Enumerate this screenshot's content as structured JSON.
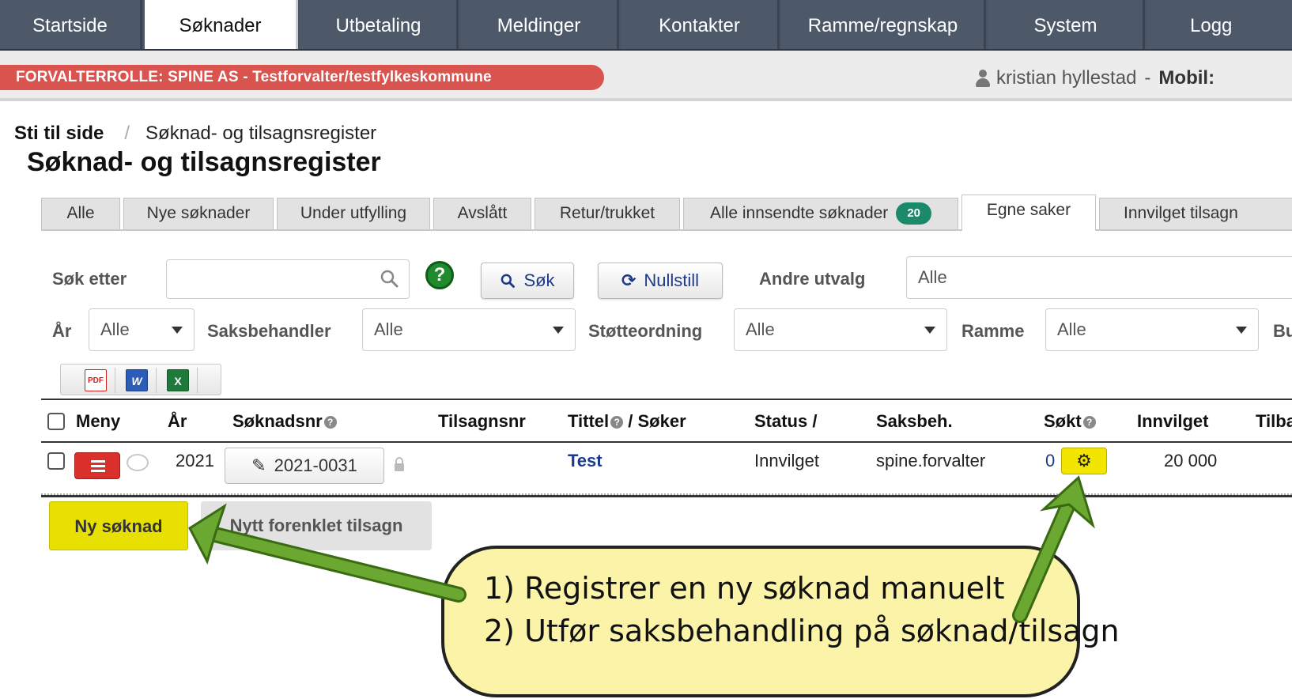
{
  "nav": {
    "tabs": [
      {
        "label": "Startside"
      },
      {
        "label": "Søknader"
      },
      {
        "label": "Utbetaling"
      },
      {
        "label": "Meldinger"
      },
      {
        "label": "Kontakter"
      },
      {
        "label": "Ramme/regnskap"
      },
      {
        "label": "System"
      },
      {
        "label": "Logg"
      }
    ],
    "active": "Søknader"
  },
  "rolebar": {
    "role": "FORVALTERROLLE: SPINE AS - Testforvalter/testfylkeskommune",
    "user_name": "kristian hyllestad",
    "user_sep": "-",
    "user_extra": "Mobil:"
  },
  "breadcrumb": {
    "root": "Sti til side",
    "separator": "/",
    "current": "Søknad- og tilsagnsregister"
  },
  "page_title": "Søknad- og tilsagnsregister",
  "filter_tabs": [
    {
      "label": "Alle"
    },
    {
      "label": "Nye søknader"
    },
    {
      "label": "Under utfylling"
    },
    {
      "label": "Avslått"
    },
    {
      "label": "Retur/trukket"
    },
    {
      "label": "Alle innsendte søknader",
      "count": "20"
    },
    {
      "label": "Egne saker"
    },
    {
      "label": "Innvilget tilsagn"
    }
  ],
  "search": {
    "label": "Søk etter",
    "value": "",
    "help": "?",
    "search_button": "Søk",
    "reset_button": "Nullstill",
    "other_label": "Andre utvalg",
    "other_value": "Alle"
  },
  "filters": {
    "year_label": "År",
    "year_value": "Alle",
    "handler_label": "Saksbehandler",
    "handler_value": "Alle",
    "scheme_label": "Støtteordning",
    "scheme_value": "Alle",
    "frame_label": "Ramme",
    "frame_value": "Alle",
    "extra_label": "Bu"
  },
  "export": {
    "pdf": "PDF",
    "word": "W",
    "excel": "X"
  },
  "table": {
    "headers": {
      "menu": "Meny",
      "year": "År",
      "app_no": "Søknadsnr",
      "grant_no": "Tilsagnsnr",
      "title": "Tittel",
      "title_sep": "/ Søker",
      "status": "Status /",
      "handler": "Saksbeh.",
      "applied": "Søkt",
      "granted": "Innvilget",
      "extra": "Tilba"
    },
    "rows": [
      {
        "year": "2021",
        "app_no": "2021-0031",
        "grant_no": "",
        "title": "Test",
        "status": "Innvilget",
        "handler": "spine.forvalter",
        "applied": "0",
        "granted": "20 000"
      }
    ]
  },
  "actions": {
    "new_application": "Ny søknad",
    "simplified_grant": "Nytt forenklet tilsagn"
  },
  "callout": {
    "line1": "1) Registrer en ny søknad manuelt",
    "line2": "2) Utfør saksbehandling på søknad/tilsagn"
  },
  "colors": {
    "nav_bg": "#4a5566",
    "role_badge": "#d9534f",
    "count_badge": "#1b8a6b",
    "highlight_yellow": "#e8e000",
    "callout_bg": "#fbf3a8",
    "arrow_green": "#6aa832",
    "link_blue": "#1b3a8c"
  }
}
